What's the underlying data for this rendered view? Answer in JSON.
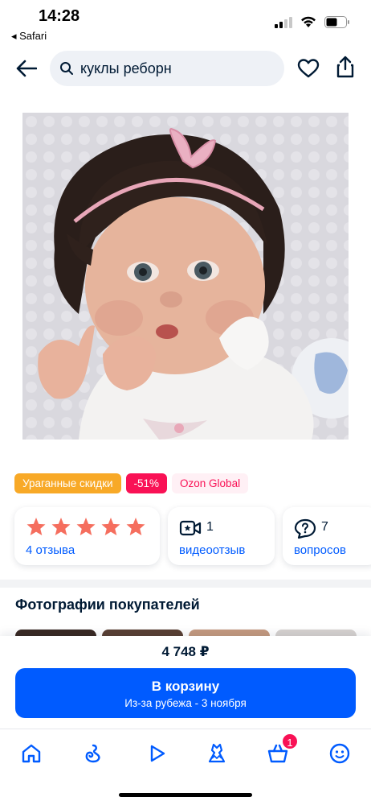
{
  "status_bar": {
    "time": "14:28",
    "back_app": "◂ Safari"
  },
  "search": {
    "query": "куклы реборн"
  },
  "badges": {
    "sale": "Ураганные скидки",
    "discount": "-51%",
    "global": "Ozon Global"
  },
  "rating": {
    "stars": 5,
    "reviews_label": "4 отзыва"
  },
  "video": {
    "count": "1",
    "label": "видеоотзыв"
  },
  "questions": {
    "count": "7",
    "label": "вопросов"
  },
  "customer_photos": {
    "title": "Фотографии покупателей"
  },
  "purchase": {
    "price": "4 748 ₽",
    "button_label": "В корзину",
    "button_sub": "Из-за рубежа - 3 ноября"
  },
  "tabbar": {
    "cart_badge": "1"
  },
  "colors": {
    "accent": "#005bff",
    "sale": "#f8a927",
    "discount": "#f91155",
    "star": "#f56e5e"
  }
}
